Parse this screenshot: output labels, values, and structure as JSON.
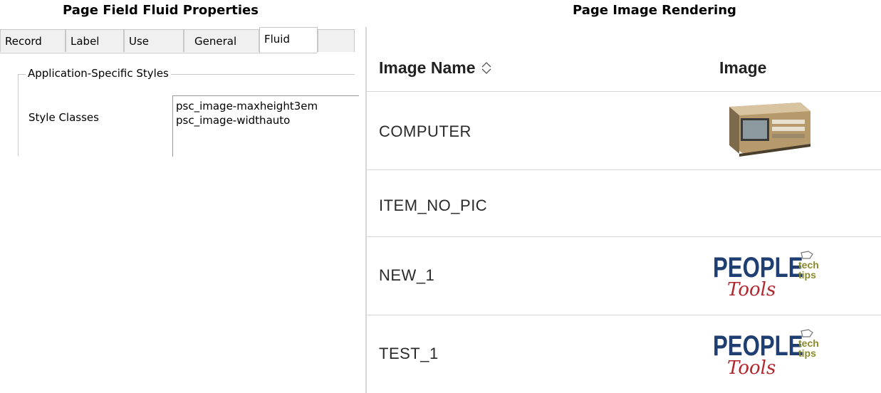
{
  "captions": {
    "left": "Page Field Fluid Properties",
    "right": "Page Image Rendering"
  },
  "properties_dialog": {
    "tabs": [
      {
        "label": "Record",
        "active": false
      },
      {
        "label": "Label",
        "active": false
      },
      {
        "label": "Use",
        "active": false
      },
      {
        "label": "General",
        "active": false
      },
      {
        "label": "Fluid",
        "active": true
      }
    ],
    "group_title": "Application-Specific Styles",
    "style_classes_label": "Style Classes",
    "style_classes_value": "psc_image-maxheight3em\npsc_image-widthauto"
  },
  "image_grid": {
    "columns": {
      "name": "Image Name",
      "name_sort_icon": "sort-updown-icon",
      "image": "Image"
    },
    "rows": [
      {
        "name": "COMPUTER",
        "image": "computer-photo"
      },
      {
        "name": "ITEM_NO_PIC",
        "image": ""
      },
      {
        "name": "NEW_1",
        "image": "peopletools-tech-tips-logo"
      },
      {
        "name": "TEST_1",
        "image": "peopletools-tech-tips-logo"
      }
    ]
  },
  "logo_text": {
    "main": "PEOPLE",
    "tech": "tech",
    "tips": "tips",
    "script": "Tools"
  },
  "colors": {
    "logo_blue": "#1f3f73",
    "logo_red": "#b3262e",
    "logo_olive": "#8a8a2a"
  }
}
